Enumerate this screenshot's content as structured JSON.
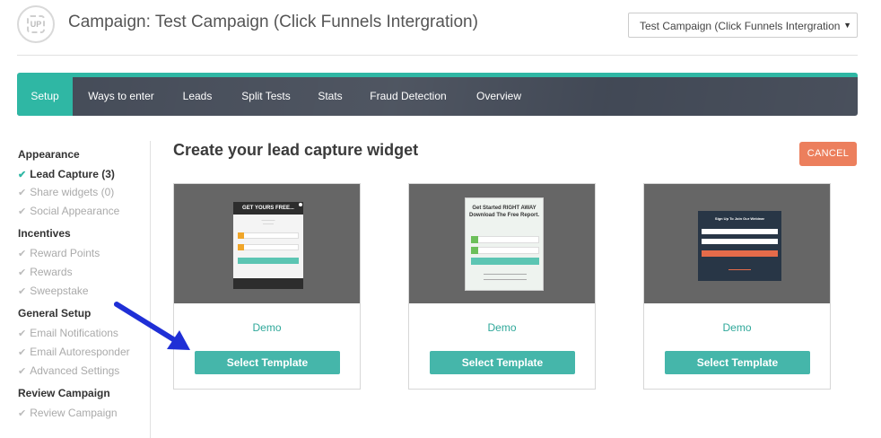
{
  "header": {
    "logo_text": "UP",
    "title": "Campaign: Test Campaign (Click Funnels Intergration)",
    "campaign_select_value": "Test Campaign (Click Funnels Intergration"
  },
  "tabs": [
    {
      "label": "Setup",
      "active": true
    },
    {
      "label": "Ways to enter",
      "active": false
    },
    {
      "label": "Leads",
      "active": false
    },
    {
      "label": "Split Tests",
      "active": false
    },
    {
      "label": "Stats",
      "active": false
    },
    {
      "label": "Fraud Detection",
      "active": false
    },
    {
      "label": "Overview",
      "active": false
    }
  ],
  "sidebar": {
    "sections": [
      {
        "heading": "Appearance",
        "items": [
          "Lead Capture (3)",
          "Share widgets (0)",
          "Social Appearance"
        ]
      },
      {
        "heading": "Incentives",
        "items": [
          "Reward Points",
          "Rewards",
          "Sweepstake"
        ]
      },
      {
        "heading": "General Setup",
        "items": [
          "Email Notifications",
          "Email Autoresponder",
          "Advanced Settings"
        ]
      },
      {
        "heading": "Review Campaign",
        "items": [
          "Review Campaign"
        ]
      }
    ],
    "current_item": "Lead Capture (3)"
  },
  "main": {
    "title": "Create your lead capture widget",
    "cancel_label": "CANCEL",
    "templates": [
      {
        "demo_label": "Demo",
        "select_label": "Select Template",
        "preview_heading": "GET YOURS FREE..."
      },
      {
        "demo_label": "Demo",
        "select_label": "Select Template",
        "preview_heading": "Get Started RIGHT AWAY Download The Free Report."
      },
      {
        "demo_label": "Demo",
        "select_label": "Select Template",
        "preview_heading": "Sign Up To Join Our Webinar"
      }
    ]
  },
  "colors": {
    "accent": "#2fb7a4",
    "tabbar": "#3e4552",
    "cancel": "#ec7f5d",
    "select_button": "#45b6aa",
    "arrow": "#1f2fd6"
  },
  "icons": {
    "check": "check-icon",
    "caret": "caret-down-icon",
    "arrow": "blue-pointer-arrow"
  }
}
